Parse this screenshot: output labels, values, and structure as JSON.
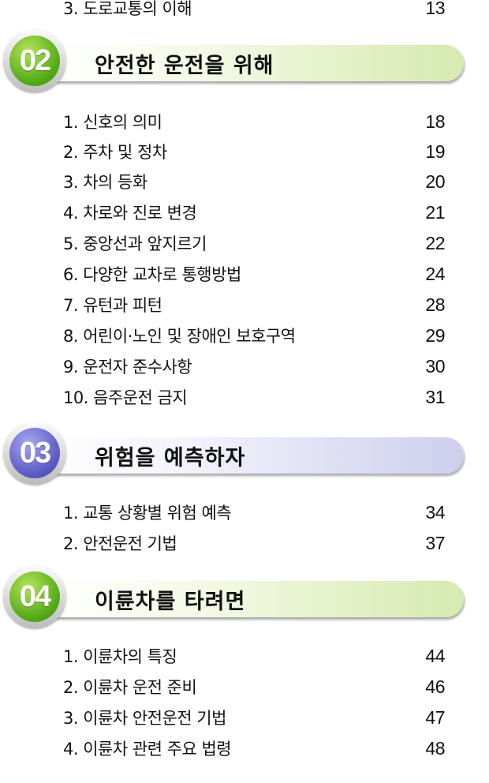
{
  "top_item": {
    "label": "3. 도로교통의 이해",
    "page": "13"
  },
  "sections": [
    {
      "number": "02",
      "title": "안전한 운전을 위해",
      "items": [
        {
          "label": "1. 신호의 의미",
          "page": "18"
        },
        {
          "label": "2. 주차 및 정차",
          "page": "19"
        },
        {
          "label": "3. 차의 등화",
          "page": "20"
        },
        {
          "label": "4. 차로와 진로 변경",
          "page": "21"
        },
        {
          "label": "5. 중앙선과 앞지르기",
          "page": "22"
        },
        {
          "label": "6. 다양한 교차로 통행방법",
          "page": "24"
        },
        {
          "label": "7. 유턴과 피턴",
          "page": "28"
        },
        {
          "label": "8. 어린이·노인 및 장애인 보호구역",
          "page": "29"
        },
        {
          "label": "9. 운전자 준수사항",
          "page": "30"
        },
        {
          "label": "10. 음주운전 금지",
          "page": "31"
        }
      ]
    },
    {
      "number": "03",
      "title": "위험을 예측하자",
      "items": [
        {
          "label": "1. 교통 상황별 위험 예측",
          "page": "34"
        },
        {
          "label": "2. 안전운전 기법",
          "page": "37"
        }
      ]
    },
    {
      "number": "04",
      "title": "이륜차를 타려면",
      "items": [
        {
          "label": "1. 이륜차의 특징",
          "page": "44"
        },
        {
          "label": "2. 이륜차 운전 준비",
          "page": "46"
        },
        {
          "label": "3. 이륜차 안전운전 기법",
          "page": "47"
        },
        {
          "label": "4. 이륜차 관련 주요 법령",
          "page": "48"
        }
      ]
    }
  ]
}
